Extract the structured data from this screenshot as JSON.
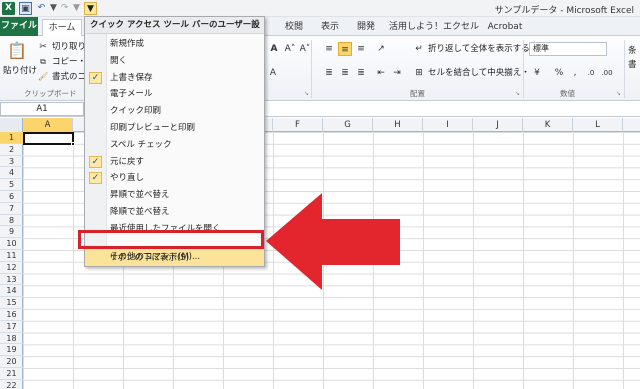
{
  "titlebar": {
    "window_title": "サンプルデータ - Microsoft Excel",
    "icons": [
      "excel-logo-icon",
      "save-icon",
      "undo-icon",
      "redo-icon",
      "qat-customize-icon"
    ]
  },
  "tabs": [
    {
      "label": "ファイル"
    },
    {
      "label": "ホーム"
    },
    {
      "label": "校閲"
    },
    {
      "label": "表示"
    },
    {
      "label": "開発"
    },
    {
      "label": "活用しよう！エクセル"
    },
    {
      "label": "Acrobat"
    }
  ],
  "ribbon": {
    "paste_label": "貼り付け",
    "cut_label": "切り取り",
    "copy_label": "コピー・",
    "format_painter_label": "書式のコ",
    "clipboard_group": "クリップボード",
    "wrap_text_label": "折り返して全体を表示する",
    "merge_center_label": "セルを結合して中央揃え・",
    "alignment_group": "配置",
    "number_format_value": "標準",
    "number_group": "数値",
    "conditional_label": "条",
    "format_label": "書"
  },
  "formula_bar": {
    "name_box": "A1"
  },
  "grid": {
    "columns": [
      "A",
      "B",
      "C",
      "D",
      "E",
      "F",
      "G",
      "H",
      "I",
      "J",
      "K",
      "L"
    ],
    "rows": [
      "1",
      "2",
      "3",
      "4",
      "5",
      "6",
      "7",
      "8",
      "9",
      "10",
      "11",
      "12",
      "13",
      "14",
      "15",
      "16",
      "17",
      "18",
      "19",
      "20",
      "21",
      "22"
    ],
    "active_cell": "A1"
  },
  "menu": {
    "header": "クイック アクセス ツール バーのユーザー設定",
    "items": [
      {
        "label": "新規作成",
        "checked": false
      },
      {
        "label": "開く",
        "checked": false
      },
      {
        "label": "上書き保存",
        "checked": true
      },
      {
        "label": "電子メール",
        "checked": false
      },
      {
        "label": "クイック印刷",
        "checked": false
      },
      {
        "label": "印刷プレビューと印刷",
        "checked": false
      },
      {
        "label": "スペル チェック",
        "checked": false
      },
      {
        "label": "元に戻す",
        "checked": true
      },
      {
        "label": "やり直し",
        "checked": true
      },
      {
        "label": "昇順で並べ替え",
        "checked": false
      },
      {
        "label": "降順で並べ替え",
        "checked": false
      },
      {
        "label": "最近使用したファイルを開く",
        "checked": false
      }
    ],
    "more_commands": "その他のコマンド(M)...",
    "show_below": "リボンの下に表示(S)"
  },
  "colors": {
    "file_tab": "#1f7244",
    "highlight": "#fbe39a",
    "annotation_red": "#e3262e"
  }
}
